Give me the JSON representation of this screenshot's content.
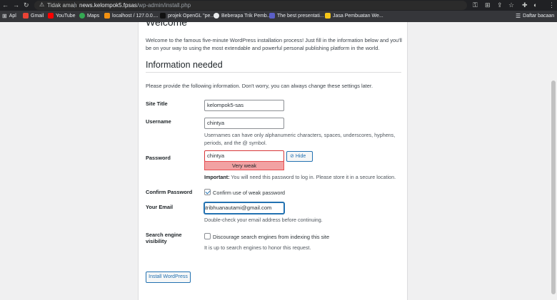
{
  "browser": {
    "security_label": "Tidak aman",
    "url_host": "news.kelompok5.fpsas",
    "url_path": "/wp-admin/install.php",
    "bookmarks": [
      {
        "label": "Apl"
      },
      {
        "label": "Gmail"
      },
      {
        "label": "YouTube"
      },
      {
        "label": "Maps"
      },
      {
        "label": "localhost / 127.0.0...."
      },
      {
        "label": "projek OpenGL \"pe..."
      },
      {
        "label": "Beberapa Trik Pemb..."
      },
      {
        "label": "The best presentati..."
      },
      {
        "label": "Jasa Pembuatan We..."
      },
      {
        "label": "Daftar bacaan"
      }
    ]
  },
  "install": {
    "welcome_heading": "Welcome",
    "intro": "Welcome to the famous five-minute WordPress installation process! Just fill in the information below and you'll be on your way to using the most extendable and powerful personal publishing platform in the world.",
    "info_heading": "Information needed",
    "info_desc": "Please provide the following information. Don't worry, you can always change these settings later.",
    "site_title": {
      "label": "Site Title",
      "value": "kelompok5-sas"
    },
    "username": {
      "label": "Username",
      "value": "chintya",
      "help_line1": "Usernames can have only alphanumeric characters, spaces, underscores, hyphens,",
      "help_line2": "periods, and the @ symbol."
    },
    "password": {
      "label": "Password",
      "value": "chintya",
      "strength": "Very weak",
      "hide_button": "Hide",
      "important_bold": "Important:",
      "important_text": " You will need this password to log in. Please store it in a secure location."
    },
    "confirm_password": {
      "label": "Confirm Password",
      "checkbox_label": "Confirm use of weak password",
      "checked": true
    },
    "email": {
      "label": "Your Email",
      "value": "ityatribhuanautami@gmail.com",
      "help": "Double-check your email address before continuing."
    },
    "search_visibility": {
      "label_line1": "Search engine",
      "label_line2": "visibility",
      "checkbox_label": "Discourage search engines from indexing this site",
      "checked": false,
      "help": "It is up to search engines to honor this request."
    },
    "submit_label": "Install WordPress"
  },
  "colors": {
    "accent": "#2271b1",
    "weak": "#f2a2a3",
    "error": "#d63638"
  }
}
